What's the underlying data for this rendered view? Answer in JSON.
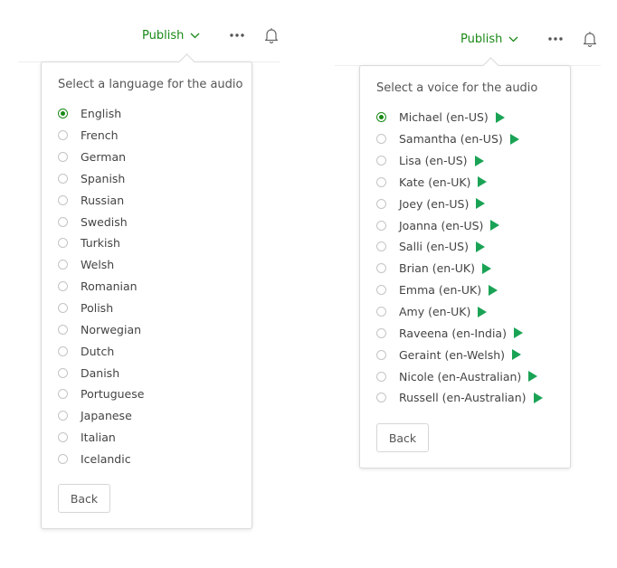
{
  "colors": {
    "accent": "#1a8917",
    "play": "#1aa355",
    "border": "#dadada"
  },
  "left": {
    "topbar": {
      "publish_label": "Publish",
      "publish_icon": "chevron-down-icon",
      "more_icon": "more-icon",
      "bell_icon": "bell-icon"
    },
    "panel": {
      "title": "Select a language for the audio",
      "selected": "English",
      "options": [
        {
          "label": "English",
          "checked": true
        },
        {
          "label": "French",
          "checked": false
        },
        {
          "label": "German",
          "checked": false
        },
        {
          "label": "Spanish",
          "checked": false
        },
        {
          "label": "Russian",
          "checked": false
        },
        {
          "label": "Swedish",
          "checked": false
        },
        {
          "label": "Turkish",
          "checked": false
        },
        {
          "label": "Welsh",
          "checked": false
        },
        {
          "label": "Romanian",
          "checked": false
        },
        {
          "label": "Polish",
          "checked": false
        },
        {
          "label": "Norwegian",
          "checked": false
        },
        {
          "label": "Dutch",
          "checked": false
        },
        {
          "label": "Danish",
          "checked": false
        },
        {
          "label": "Portuguese",
          "checked": false
        },
        {
          "label": "Japanese",
          "checked": false
        },
        {
          "label": "Italian",
          "checked": false
        },
        {
          "label": "Icelandic",
          "checked": false
        }
      ],
      "back_label": "Back"
    }
  },
  "right": {
    "topbar": {
      "publish_label": "Publish",
      "publish_icon": "chevron-down-icon",
      "more_icon": "more-icon",
      "bell_icon": "bell-icon"
    },
    "panel": {
      "title": "Select a voice for the audio",
      "selected": "Michael (en-US)",
      "options": [
        {
          "label": "Michael (en-US)",
          "checked": true
        },
        {
          "label": "Samantha (en-US)",
          "checked": false
        },
        {
          "label": "Lisa (en-US)",
          "checked": false
        },
        {
          "label": "Kate (en-UK)",
          "checked": false
        },
        {
          "label": "Joey (en-US)",
          "checked": false
        },
        {
          "label": "Joanna (en-US)",
          "checked": false
        },
        {
          "label": "Salli (en-US)",
          "checked": false
        },
        {
          "label": "Brian (en-UK)",
          "checked": false
        },
        {
          "label": "Emma (en-UK)",
          "checked": false
        },
        {
          "label": "Amy (en-UK)",
          "checked": false
        },
        {
          "label": "Raveena (en-India)",
          "checked": false
        },
        {
          "label": "Geraint (en-Welsh)",
          "checked": false
        },
        {
          "label": "Nicole (en-Australian)",
          "checked": false
        },
        {
          "label": "Russell (en-Australian)",
          "checked": false
        }
      ],
      "play_icon": "play-icon",
      "back_label": "Back"
    }
  }
}
